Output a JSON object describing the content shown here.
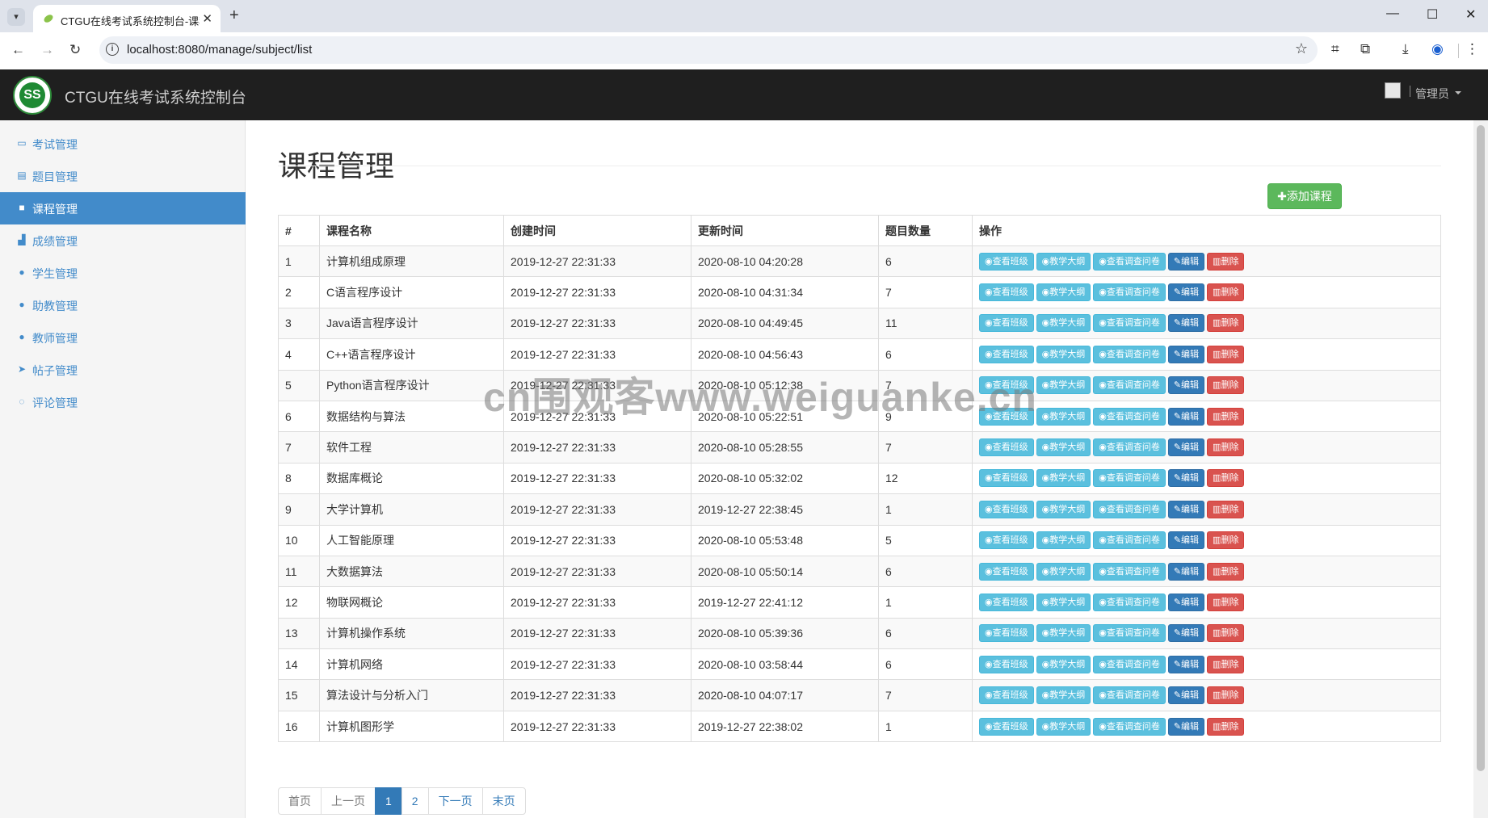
{
  "browser": {
    "tab_title": "CTGU在线考试系统控制台-课程",
    "url": "localhost:8080/manage/subject/list"
  },
  "header": {
    "brand": "CTGU在线考试系统控制台",
    "user": "管理员"
  },
  "sidebar": {
    "items": [
      {
        "label": "考试管理",
        "icon": "monitor-icon"
      },
      {
        "label": "题目管理",
        "icon": "list-icon"
      },
      {
        "label": "课程管理",
        "icon": "book-icon",
        "active": true
      },
      {
        "label": "成绩管理",
        "icon": "bar-chart-icon"
      },
      {
        "label": "学生管理",
        "icon": "user-icon"
      },
      {
        "label": "助教管理",
        "icon": "user-icon"
      },
      {
        "label": "教师管理",
        "icon": "user-icon"
      },
      {
        "label": "帖子管理",
        "icon": "send-icon"
      },
      {
        "label": "评论管理",
        "icon": "comment-icon"
      }
    ]
  },
  "main": {
    "title": "课程管理",
    "add_button": "✚添加课程",
    "columns": [
      "#",
      "课程名称",
      "创建时间",
      "更新时间",
      "题目数量",
      "操作"
    ],
    "actions": {
      "view_class": "查看班级",
      "syllabus": "教学大纲",
      "survey": "查看调查问卷",
      "edit": "编辑",
      "delete": "删除"
    },
    "rows": [
      {
        "id": "1",
        "name": "计算机组成原理",
        "created": "2019-12-27 22:31:33",
        "updated": "2020-08-10 04:20:28",
        "count": "6"
      },
      {
        "id": "2",
        "name": "C语言程序设计",
        "created": "2019-12-27 22:31:33",
        "updated": "2020-08-10 04:31:34",
        "count": "7"
      },
      {
        "id": "3",
        "name": "Java语言程序设计",
        "created": "2019-12-27 22:31:33",
        "updated": "2020-08-10 04:49:45",
        "count": "11"
      },
      {
        "id": "4",
        "name": "C++语言程序设计",
        "created": "2019-12-27 22:31:33",
        "updated": "2020-08-10 04:56:43",
        "count": "6"
      },
      {
        "id": "5",
        "name": "Python语言程序设计",
        "created": "2019-12-27 22:31:33",
        "updated": "2020-08-10 05:12:38",
        "count": "7"
      },
      {
        "id": "6",
        "name": "数据结构与算法",
        "created": "2019-12-27 22:31:33",
        "updated": "2020-08-10 05:22:51",
        "count": "9"
      },
      {
        "id": "7",
        "name": "软件工程",
        "created": "2019-12-27 22:31:33",
        "updated": "2020-08-10 05:28:55",
        "count": "7"
      },
      {
        "id": "8",
        "name": "数据库概论",
        "created": "2019-12-27 22:31:33",
        "updated": "2020-08-10 05:32:02",
        "count": "12"
      },
      {
        "id": "9",
        "name": "大学计算机",
        "created": "2019-12-27 22:31:33",
        "updated": "2019-12-27 22:38:45",
        "count": "1"
      },
      {
        "id": "10",
        "name": "人工智能原理",
        "created": "2019-12-27 22:31:33",
        "updated": "2020-08-10 05:53:48",
        "count": "5"
      },
      {
        "id": "11",
        "name": "大数据算法",
        "created": "2019-12-27 22:31:33",
        "updated": "2020-08-10 05:50:14",
        "count": "6"
      },
      {
        "id": "12",
        "name": "物联网概论",
        "created": "2019-12-27 22:31:33",
        "updated": "2019-12-27 22:41:12",
        "count": "1"
      },
      {
        "id": "13",
        "name": "计算机操作系统",
        "created": "2019-12-27 22:31:33",
        "updated": "2020-08-10 05:39:36",
        "count": "6"
      },
      {
        "id": "14",
        "name": "计算机网络",
        "created": "2019-12-27 22:31:33",
        "updated": "2020-08-10 03:58:44",
        "count": "6"
      },
      {
        "id": "15",
        "name": "算法设计与分析入门",
        "created": "2019-12-27 22:31:33",
        "updated": "2020-08-10 04:07:17",
        "count": "7"
      },
      {
        "id": "16",
        "name": "计算机图形学",
        "created": "2019-12-27 22:31:33",
        "updated": "2019-12-27 22:38:02",
        "count": "1"
      }
    ],
    "pagination": [
      "首页",
      "上一页",
      "1",
      "2",
      "下一页",
      "末页"
    ],
    "current_page": "1"
  },
  "watermark": "cn围观客www.weiguanke.cn",
  "colors": {
    "header_bg": "#1f1f1f",
    "active_nav": "#428bca",
    "btn_info": "#5bc0de",
    "btn_primary": "#337ab7",
    "btn_danger": "#d9534f",
    "btn_success": "#5cb85c"
  }
}
